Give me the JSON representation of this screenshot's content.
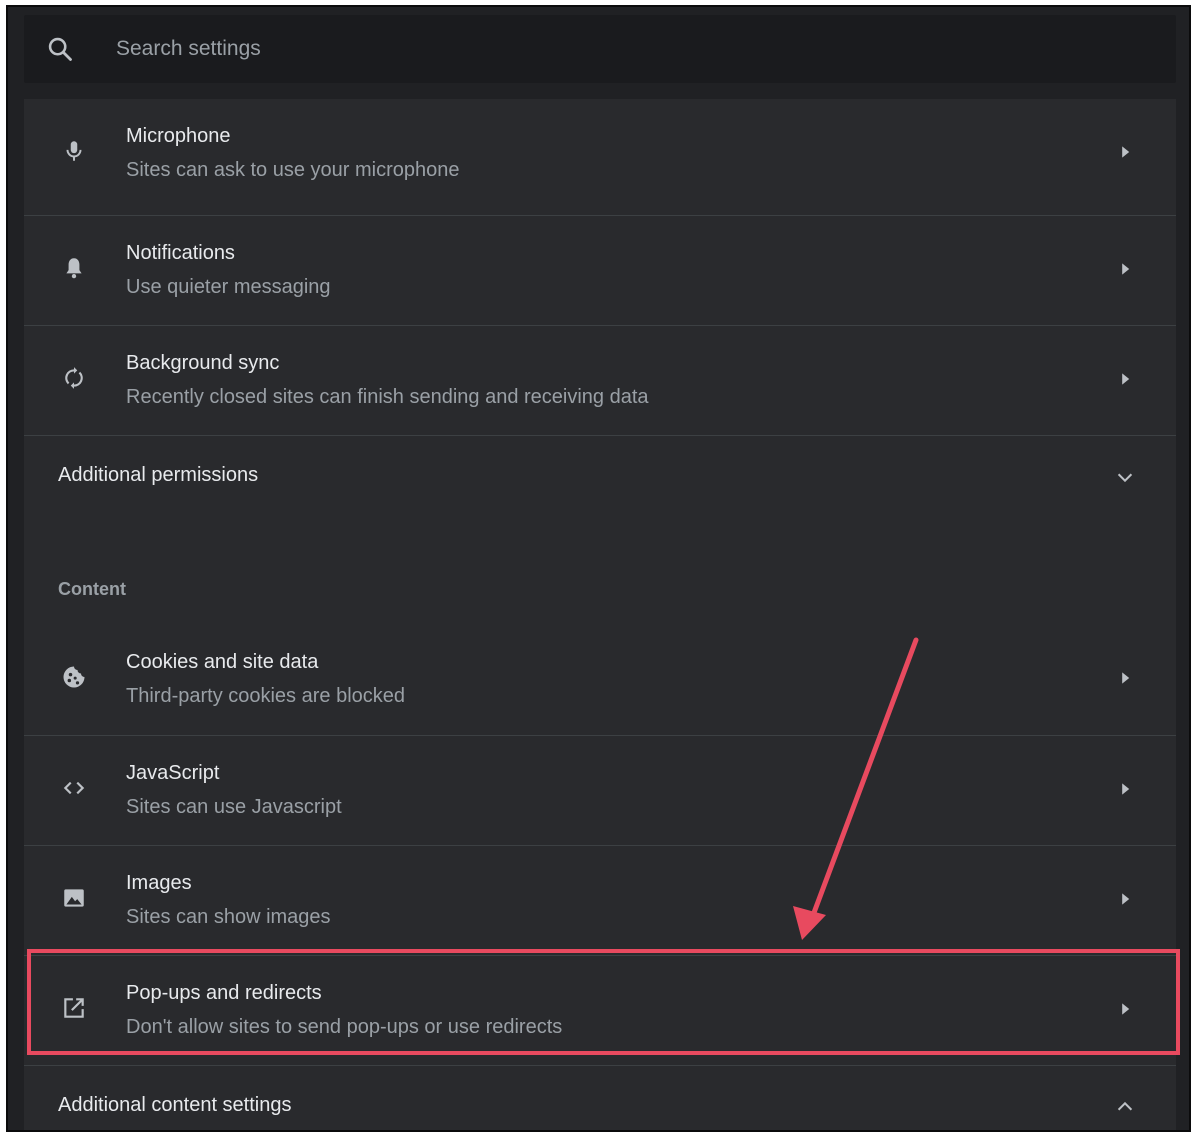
{
  "search": {
    "placeholder": "Search settings",
    "icon": "search-icon"
  },
  "permissions": {
    "items": [
      {
        "title": "Microphone",
        "subtitle": "Sites can ask to use your microphone",
        "icon": "microphone-icon"
      },
      {
        "title": "Notifications",
        "subtitle": "Use quieter messaging",
        "icon": "bell-icon"
      },
      {
        "title": "Background sync",
        "subtitle": "Recently closed sites can finish sending and receiving data",
        "icon": "sync-icon"
      }
    ],
    "additional_label": "Additional permissions"
  },
  "content": {
    "section_label": "Content",
    "items": [
      {
        "title": "Cookies and site data",
        "subtitle": "Third-party cookies are blocked",
        "icon": "cookie-icon"
      },
      {
        "title": "JavaScript",
        "subtitle": "Sites can use Javascript",
        "icon": "code-icon"
      },
      {
        "title": "Images",
        "subtitle": "Sites can show images",
        "icon": "image-icon"
      },
      {
        "title": "Pop-ups and redirects",
        "subtitle": "Don't allow sites to send pop-ups or use redirects",
        "icon": "open-in-new-icon"
      }
    ],
    "additional_label": "Additional content settings"
  },
  "colors": {
    "background": "#202124",
    "panel": "#292a2d",
    "text_primary": "#e8eaed",
    "text_secondary": "#9aa0a6",
    "annotation": "#e84a5f"
  }
}
